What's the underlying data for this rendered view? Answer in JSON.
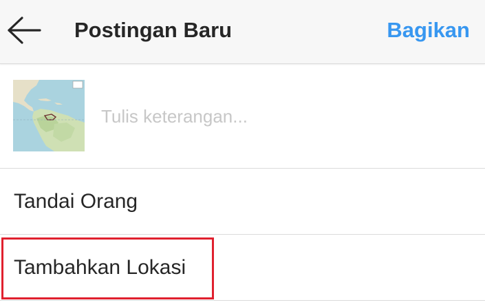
{
  "header": {
    "back_icon": "arrow-left-icon",
    "title": "Postingan Baru",
    "share_label": "Bagikan",
    "share_color": "#3897f0"
  },
  "caption": {
    "placeholder": "Tulis keterangan...",
    "value": ""
  },
  "options": {
    "tag_people_label": "Tandai Orang",
    "add_location_label": "Tambahkan Lokasi"
  },
  "highlight_color": "#e0202e"
}
